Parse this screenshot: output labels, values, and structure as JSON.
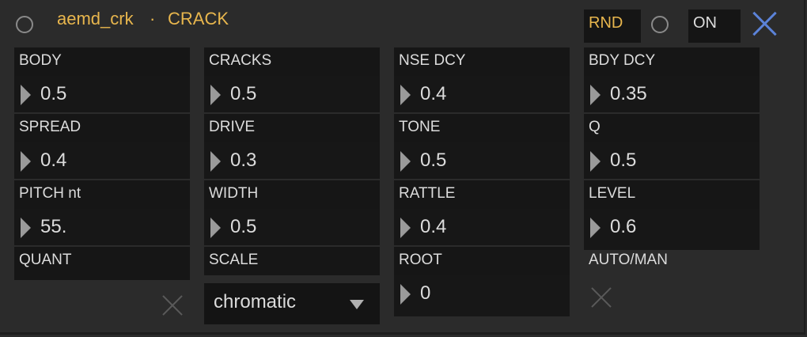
{
  "header": {
    "device_name": "aemd_crk",
    "separator": "·",
    "preset_name": "CRACK",
    "rnd_label": "RND",
    "on_label": "ON"
  },
  "params": {
    "body": {
      "label": "BODY",
      "value": "0.5"
    },
    "spread": {
      "label": "SPREAD",
      "value": "0.4"
    },
    "pitch": {
      "label": "PITCH nt",
      "value": "55."
    },
    "quant": {
      "label": "QUANT"
    },
    "cracks": {
      "label": "CRACKS",
      "value": "0.5"
    },
    "drive": {
      "label": "DRIVE",
      "value": "0.3"
    },
    "width": {
      "label": "WIDTH",
      "value": "0.5"
    },
    "scale": {
      "label": "SCALE",
      "value": "chromatic"
    },
    "nse_dcy": {
      "label": "NSE DCY",
      "value": "0.4"
    },
    "tone": {
      "label": "TONE",
      "value": "0.5"
    },
    "rattle": {
      "label": "RATTLE",
      "value": "0.4"
    },
    "root": {
      "label": "ROOT",
      "value": "0"
    },
    "bdy_dcy": {
      "label": "BDY DCY",
      "value": "0.35"
    },
    "q": {
      "label": "Q",
      "value": "0.5"
    },
    "level": {
      "label": "LEVEL",
      "value": "0.6"
    },
    "auto_man": {
      "label": "AUTO/MAN"
    }
  },
  "colors": {
    "title": "#e8b64d",
    "close": "#5b82d8",
    "background": "#2b2b2b"
  }
}
